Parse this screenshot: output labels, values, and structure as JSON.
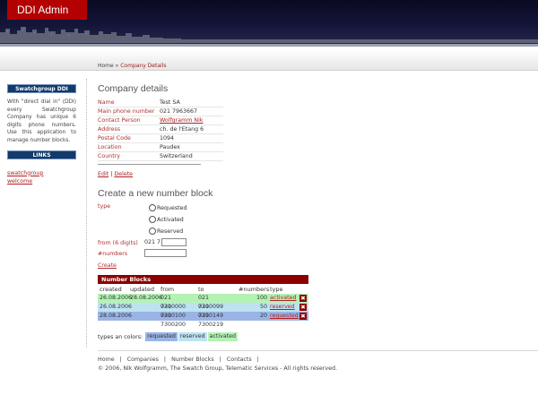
{
  "app": {
    "title": "DDI Admin"
  },
  "breadcrumb": {
    "home": "Home",
    "separator": "»",
    "current": "Company Details"
  },
  "sidebar": {
    "box_title": "Swatchgroup DDI",
    "description": "With \"direct dial in\" (DDI) every Swatchgroup Company has unique 6 digits phone numbers. Use this application to manage number blocks.",
    "links_title": "LINKS",
    "links": [
      "swatchgroup",
      "welcome"
    ]
  },
  "company": {
    "heading": "Company details",
    "fields": [
      {
        "label": "Name",
        "value": "Test SA"
      },
      {
        "label": "Main phone number",
        "value": "021 7963667"
      },
      {
        "label": "Contact Person",
        "value": "Wolfgramm Nik",
        "link": true
      },
      {
        "label": "Address",
        "value": "ch. de l'Etang 6"
      },
      {
        "label": "Postal Code",
        "value": "1094"
      },
      {
        "label": "Location",
        "value": "Paudex"
      },
      {
        "label": "Country",
        "value": "Switzerland"
      }
    ],
    "edit_label": "Edit",
    "delete_label": "Delete",
    "action_sep": "|"
  },
  "new_block": {
    "heading": "Create a new number block",
    "type_label": "type",
    "options": [
      "Requested",
      "Activated",
      "Reserved"
    ],
    "from_label": "from (6 digits)",
    "from_prefix": "021 7",
    "from_value": "",
    "numbers_label": "#numbers",
    "numbers_value": "",
    "create_label": "Create"
  },
  "number_blocks": {
    "title": "Number Blocks",
    "columns": [
      "created",
      "updated",
      "from",
      "to",
      "#numbers",
      "type"
    ],
    "rows": [
      {
        "created": "26.08.2006",
        "updated": "28.08.2006",
        "from": "021 7300000",
        "to": "021 7300099",
        "numbers": "100",
        "type": "activated",
        "status": "act"
      },
      {
        "created": "26.08.2006",
        "updated": "",
        "from": "021 7300100",
        "to": "021 7300149",
        "numbers": "50",
        "type": "reserved",
        "status": "res"
      },
      {
        "created": "28.08.2006",
        "updated": "",
        "from": "021 7300200",
        "to": "021 7300219",
        "numbers": "20",
        "type": "requested",
        "status": "req"
      }
    ],
    "delete_glyph": "✖"
  },
  "legend": {
    "label": "types an colors:",
    "items": [
      "requested",
      "reserved",
      "activated"
    ]
  },
  "colors": {
    "header_red": "#b30000",
    "table_header": "#8b0000",
    "activated": "#b4f2b4",
    "reserved": "#bde3f1",
    "requested": "#9ab4e6",
    "link": "#b02020",
    "sidebar_box": "#123a6b"
  },
  "footer": {
    "links": [
      "Home",
      "Companies",
      "Number Blocks",
      "Contacts"
    ],
    "separator": "|",
    "copyright": "© 2006, Nik Wolfgramm, The Swatch Group, Telematic Services - All rights reserved."
  }
}
